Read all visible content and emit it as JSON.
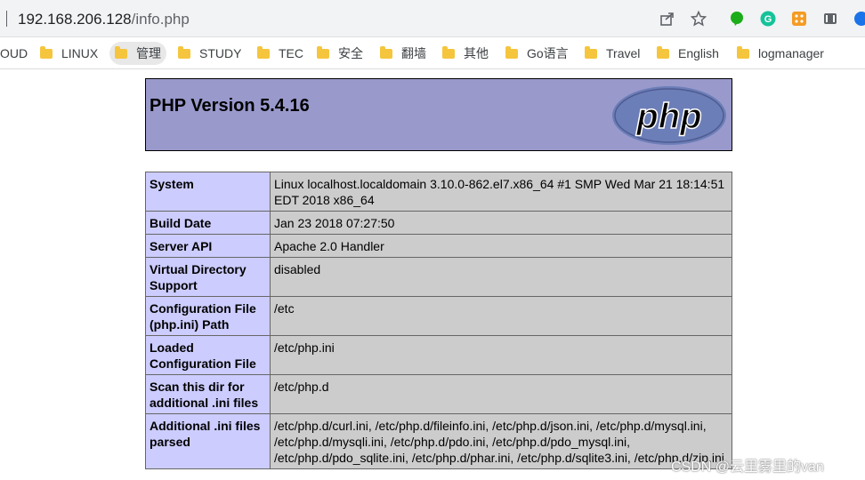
{
  "browser": {
    "url_host": "192.168.206.128",
    "url_path": "/info.php"
  },
  "bookmarks": [
    {
      "label": "OUD"
    },
    {
      "label": "LINUX"
    },
    {
      "label": "管理"
    },
    {
      "label": "STUDY"
    },
    {
      "label": "TEC"
    },
    {
      "label": "安全"
    },
    {
      "label": "翻墙"
    },
    {
      "label": "其他"
    },
    {
      "label": "Go语言"
    },
    {
      "label": "Travel"
    },
    {
      "label": "English"
    },
    {
      "label": "logmanager"
    }
  ],
  "php": {
    "title": "PHP Version 5.4.16",
    "logo_text": "php"
  },
  "info_rows": [
    {
      "key": "System",
      "value": "Linux localhost.localdomain 3.10.0-862.el7.x86_64 #1 SMP Wed Mar 21 18:14:51 EDT 2018 x86_64"
    },
    {
      "key": "Build Date",
      "value": "Jan 23 2018 07:27:50"
    },
    {
      "key": "Server API",
      "value": "Apache 2.0 Handler"
    },
    {
      "key": "Virtual Directory Support",
      "value": "disabled"
    },
    {
      "key": "Configuration File (php.ini) Path",
      "value": "/etc"
    },
    {
      "key": "Loaded Configuration File",
      "value": "/etc/php.ini"
    },
    {
      "key": "Scan this dir for additional .ini files",
      "value": "/etc/php.d"
    },
    {
      "key": "Additional .ini files parsed",
      "value": "/etc/php.d/curl.ini, /etc/php.d/fileinfo.ini, /etc/php.d/json.ini, /etc/php.d/mysql.ini, /etc/php.d/mysqli.ini, /etc/php.d/pdo.ini, /etc/php.d/pdo_mysql.ini, /etc/php.d/pdo_sqlite.ini, /etc/php.d/phar.ini, /etc/php.d/sqlite3.ini, /etc/php.d/zip.ini"
    }
  ],
  "watermark": "CSDN @云里雾里的van",
  "colors": {
    "header_bg": "#9999cc",
    "key_bg": "#ccccff",
    "value_bg": "#cccccc"
  }
}
